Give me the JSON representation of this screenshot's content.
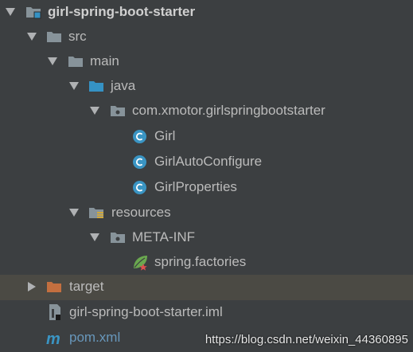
{
  "tree": {
    "root": {
      "label": "girl-spring-boot-starter",
      "icon": "module-folder-icon",
      "expanded": true
    },
    "src": {
      "label": "src",
      "icon": "folder-icon",
      "expanded": true
    },
    "main": {
      "label": "main",
      "icon": "folder-icon",
      "expanded": true
    },
    "java": {
      "label": "java",
      "icon": "source-root-folder-icon",
      "expanded": true
    },
    "package": {
      "label": "com.xmotor.girlspringbootstarter",
      "icon": "package-icon",
      "expanded": true
    },
    "class_girl": {
      "label": "Girl",
      "icon": "java-class-icon"
    },
    "class_autoconfigure": {
      "label": "GirlAutoConfigure",
      "icon": "java-class-icon"
    },
    "class_properties": {
      "label": "GirlProperties",
      "icon": "java-class-icon"
    },
    "resources": {
      "label": "resources",
      "icon": "resources-folder-icon",
      "expanded": true
    },
    "meta_inf": {
      "label": "META-INF",
      "icon": "folder-icon",
      "expanded": true
    },
    "spring_factories": {
      "label": "spring.factories",
      "icon": "spring-leaf-icon"
    },
    "target": {
      "label": "target",
      "icon": "excluded-folder-icon",
      "expanded": false,
      "selected": true
    },
    "iml": {
      "label": "girl-spring-boot-starter.iml",
      "icon": "iml-file-icon"
    },
    "pom": {
      "label": "pom.xml",
      "icon": "maven-icon"
    }
  },
  "watermark": "https://blog.csdn.net/weixin_44360895",
  "colors": {
    "background": "#3c3f41",
    "selected_row": "#4b4a44",
    "folder": "#87939a",
    "source_folder": "#3592c4",
    "excluded_folder": "#c36f3f",
    "class_icon": "#3a95c4",
    "maven_link": "#6897bb",
    "text": "#bbbbbb"
  }
}
